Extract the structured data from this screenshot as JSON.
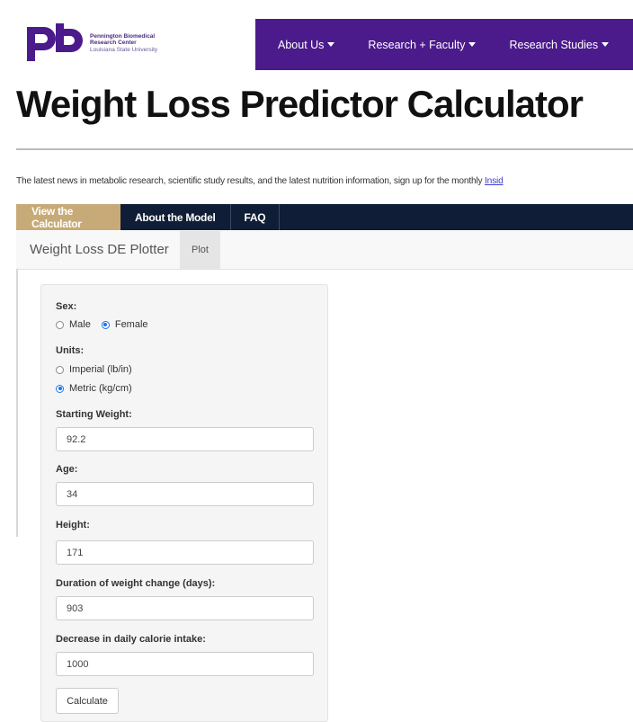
{
  "header": {
    "logo_letters": "pb",
    "logo_line1": "Pennington Biomedical",
    "logo_line2": "Research Center",
    "logo_line3": "Louisiana State University",
    "nav": [
      {
        "label": "About Us"
      },
      {
        "label": "Research + Faculty"
      },
      {
        "label": "Research Studies"
      }
    ]
  },
  "page": {
    "title": "Weight Loss Predictor Calculator",
    "news_text": "The latest news in metabolic research, scientific study results, and the latest nutrition information, sign up for the monthly ",
    "news_link": "Insid"
  },
  "tabs": [
    {
      "label": "View the Calculator",
      "active": true
    },
    {
      "label": "About the Model",
      "active": false
    },
    {
      "label": "FAQ",
      "active": false
    }
  ],
  "app": {
    "brand": "Weight Loss DE Plotter",
    "plot_tab": "Plot"
  },
  "form": {
    "sex_label": "Sex:",
    "sex_options": [
      "Male",
      "Female"
    ],
    "sex_selected": "Female",
    "units_label": "Units:",
    "units_options": [
      "Imperial (lb/in)",
      "Metric (kg/cm)"
    ],
    "units_selected": "Metric (kg/cm)",
    "weight_label": "Starting Weight:",
    "weight_value": "92.2",
    "age_label": "Age:",
    "age_value": "34",
    "height_label": "Height:",
    "height_value": "171",
    "duration_label": "Duration of weight change (days):",
    "duration_value": "903",
    "calorie_label": "Decrease in daily calorie intake:",
    "calorie_value": "1000",
    "calculate_label": "Calculate"
  },
  "colors": {
    "nav_purple": "#4b1b8c",
    "tabbar_navy": "#0f1e36",
    "active_tab_gold": "#c7aa77"
  }
}
